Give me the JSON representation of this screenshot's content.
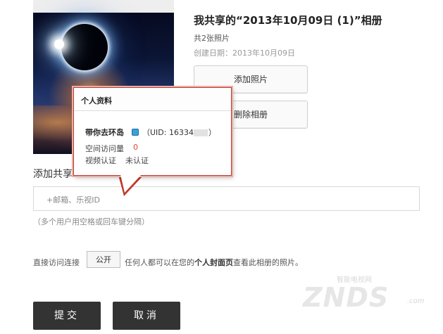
{
  "album": {
    "title": "我共享的“2013年10月09日 (1)”相册",
    "photo_count": "共2张照片",
    "create_date": "创建日期：2013年10月09日",
    "add_photo_label": "添加照片",
    "delete_album_label": "删除相册"
  },
  "share": {
    "heading": "添加共享",
    "placeholder": "+邮箱、乐视ID",
    "hint": "（多个用户用空格或回车键分隔）"
  },
  "public_link": {
    "label": "直接访问连接",
    "button": "公开",
    "desc_prefix": "任何人都可以在您的",
    "desc_strong": "个人封面页",
    "desc_suffix": "查看此相册的照片。"
  },
  "actions": {
    "submit": "提交",
    "cancel": "取消"
  },
  "profile_popup": {
    "title": "个人资料",
    "username": "带你去环岛",
    "uid_prefix": "（UID: 16334",
    "uid_suffix": "）",
    "visit_label": "空间访问量",
    "visit_count": "0",
    "video_label": "视频认证",
    "video_status": "未认证"
  },
  "watermark": {
    "top_text": "智能电视网",
    "logo_text": "ZNDS",
    "domain_suffix": ".com"
  },
  "colors": {
    "popup_border": "#c0392b",
    "visit_count": "#e04a2f",
    "dark_button": "#333333"
  },
  "icons": {
    "vip_badge": "user-badge-icon"
  }
}
